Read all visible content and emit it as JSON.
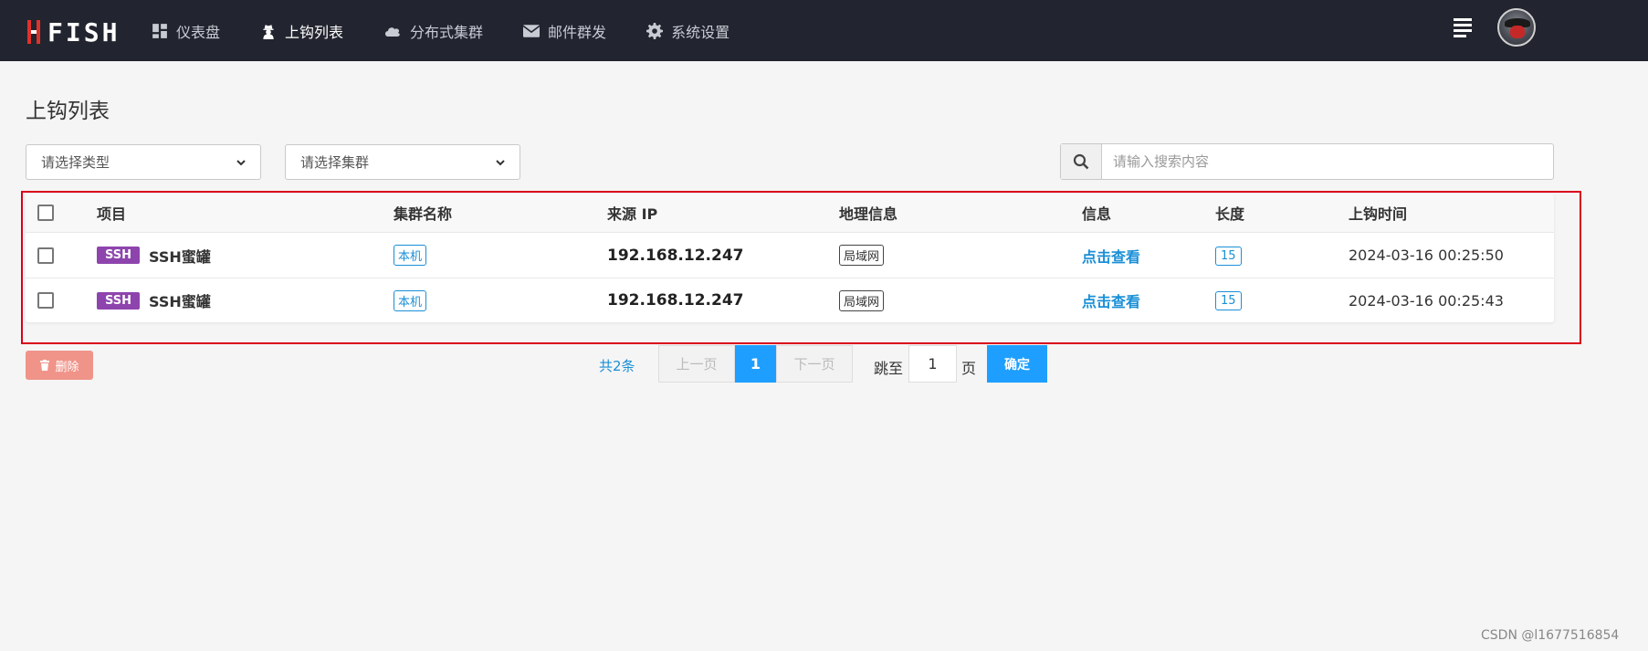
{
  "nav": {
    "items": [
      {
        "label": "仪表盘",
        "icon": "dashboard-icon"
      },
      {
        "label": "上钩列表",
        "icon": "hacker-icon"
      },
      {
        "label": "分布式集群",
        "icon": "cloud-icon"
      },
      {
        "label": "邮件群发",
        "icon": "mail-icon"
      },
      {
        "label": "系统设置",
        "icon": "gear-icon"
      }
    ],
    "active_index": 1
  },
  "page": {
    "title": "上钩列表"
  },
  "filters": {
    "type_placeholder": "请选择类型",
    "cluster_placeholder": "请选择集群",
    "search_placeholder": "请输入搜索内容"
  },
  "table": {
    "columns": [
      "项目",
      "集群名称",
      "来源 IP",
      "地理信息",
      "信息",
      "长度",
      "上钩时间"
    ],
    "rows": [
      {
        "type": "SSH",
        "project": "SSH蜜罐",
        "cluster": "本机",
        "ip": "192.168.12.247",
        "geo": "局域网",
        "info": "点击查看",
        "length": "15",
        "time": "2024-03-16 00:25:50"
      },
      {
        "type": "SSH",
        "project": "SSH蜜罐",
        "cluster": "本机",
        "ip": "192.168.12.247",
        "geo": "局域网",
        "info": "点击查看",
        "length": "15",
        "time": "2024-03-16 00:25:43"
      }
    ]
  },
  "toolbar": {
    "delete_label": "删除"
  },
  "pagination": {
    "total": "共2条",
    "prev": "上一页",
    "current": "1",
    "next": "下一页",
    "jump_label": "跳至",
    "jump_value": "1",
    "unit": "页",
    "confirm": "确定"
  },
  "watermark": "CSDN @l1677516854",
  "colors": {
    "topbar": "#22252f",
    "accent": "#1e9fff",
    "ssh_badge": "#8e44ad",
    "highlight_frame": "#d9001b",
    "delete": "#f0948a"
  }
}
